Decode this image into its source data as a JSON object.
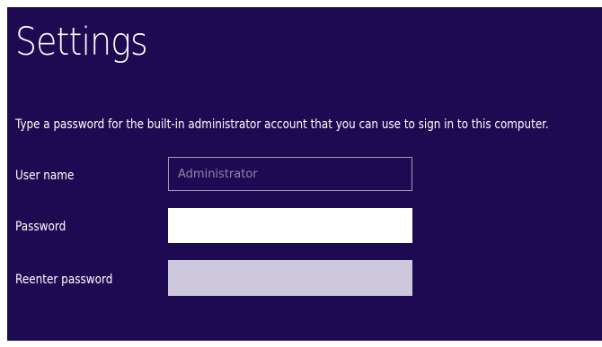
{
  "window": {
    "title": "Settings"
  },
  "instruction": "Type a password for the built-in administrator account that you can use to sign in to this computer.",
  "form": {
    "user_name": {
      "label": "User name",
      "value": "",
      "placeholder": "Administrator"
    },
    "password": {
      "label": "Password",
      "value": ""
    },
    "reenter_password": {
      "label": "Reenter password",
      "value": ""
    }
  },
  "colors": {
    "background": "#1e0a52",
    "text": "#ffffff",
    "field_active": "#ffffff",
    "field_inactive": "#cdc8dc",
    "field_disabled_border": "#a29ab8"
  }
}
